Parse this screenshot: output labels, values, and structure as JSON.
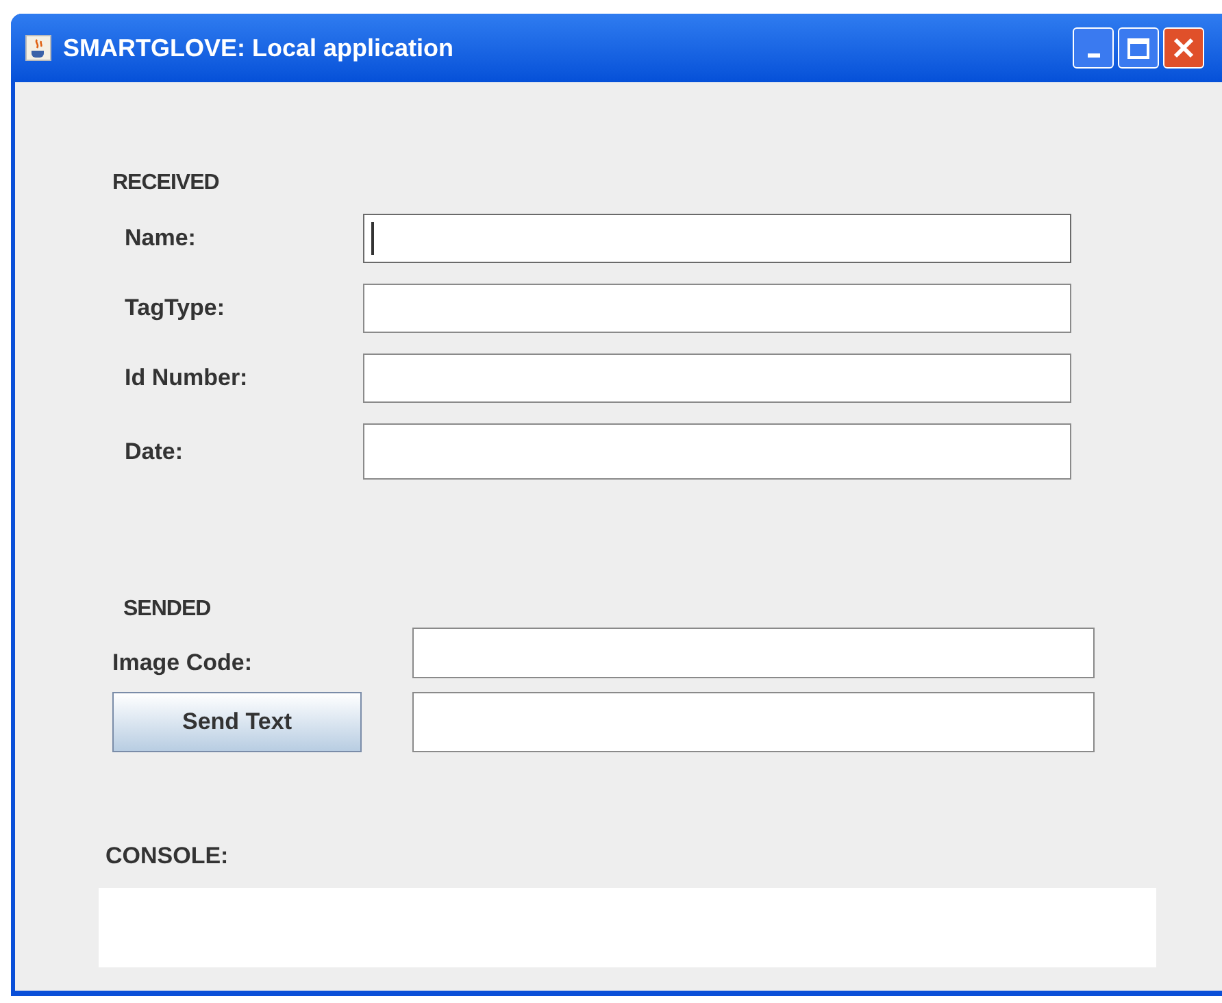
{
  "window": {
    "title": "SMARTGLOVE: Local application"
  },
  "received": {
    "heading": "RECEIVED",
    "fields": [
      {
        "label": "Name:",
        "focused": true
      },
      {
        "label": "TagType:",
        "focused": false
      },
      {
        "label": "Id Number:",
        "focused": false
      },
      {
        "label": "Date:",
        "focused": false
      }
    ]
  },
  "sended": {
    "heading": "SENDED",
    "image_code": {
      "label": "Image Code:"
    },
    "send_button": {
      "label": "Send Text"
    }
  },
  "console": {
    "heading": "CONSOLE:"
  }
}
